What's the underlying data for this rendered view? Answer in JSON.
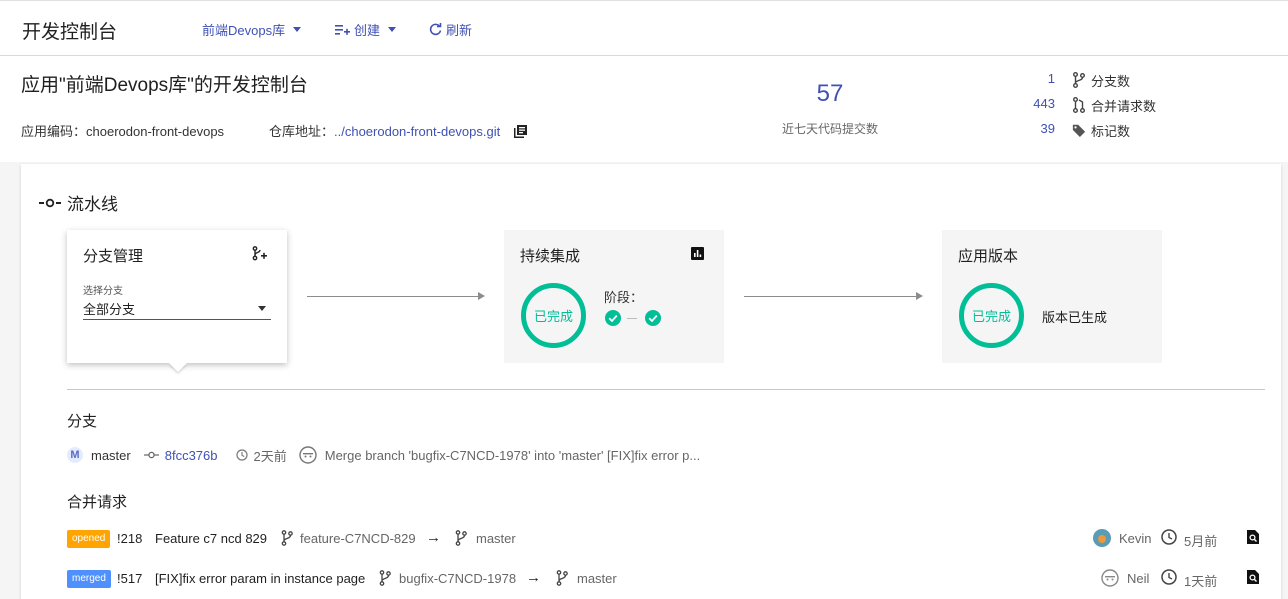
{
  "topbar": {
    "title": "开发控制台",
    "app_selector": "前端Devops库",
    "create_label": "创建",
    "refresh_label": "刷新"
  },
  "header": {
    "app_title": "应用\"前端Devops库\"的开发控制台",
    "app_code_label": "应用编码：",
    "app_code": "choerodon-front-devops",
    "repo_label": "仓库地址：",
    "repo_url": "../choerodon-front-devops.git",
    "commit_count": "57",
    "commit_count_label": "近七天代码提交数",
    "stats": [
      {
        "value": "1",
        "label": "分支数",
        "icon": "branch-icon"
      },
      {
        "value": "443",
        "label": "合并请求数",
        "icon": "merge-request-icon"
      },
      {
        "value": "39",
        "label": "标记数",
        "icon": "tag-icon"
      }
    ]
  },
  "pipeline": {
    "title": "流水线",
    "branch_stage": {
      "title": "分支管理",
      "select_label": "选择分支",
      "select_value": "全部分支"
    },
    "ci_stage": {
      "title": "持续集成",
      "status": "已完成",
      "phases_label": "阶段："
    },
    "version_stage": {
      "title": "应用版本",
      "status": "已完成",
      "message": "版本已生成"
    }
  },
  "branches": {
    "title": "分支",
    "item": {
      "avatar_letter": "M",
      "name": "master",
      "commit": "8fcc376b",
      "time": "2天前",
      "message": "Merge branch 'bugfix-C7NCD-1978' into 'master' [FIX]fix error p..."
    }
  },
  "merge_requests": {
    "title": "合并请求",
    "items": [
      {
        "state": "opened",
        "state_color": "#ffa400",
        "id": "!218",
        "title": "Feature c7 ncd 829",
        "source": "feature-C7NCD-829",
        "target": "master",
        "author": "Kevin",
        "time": "5月前"
      },
      {
        "state": "merged",
        "state_color": "#4d90fe",
        "id": "!517",
        "title": "[FIX]fix error param in instance page",
        "source": "bugfix-C7NCD-1978",
        "target": "master",
        "author": "Neil",
        "time": "1天前"
      }
    ]
  },
  "colors": {
    "accent": "#3f51b5",
    "success": "#00bf96"
  }
}
